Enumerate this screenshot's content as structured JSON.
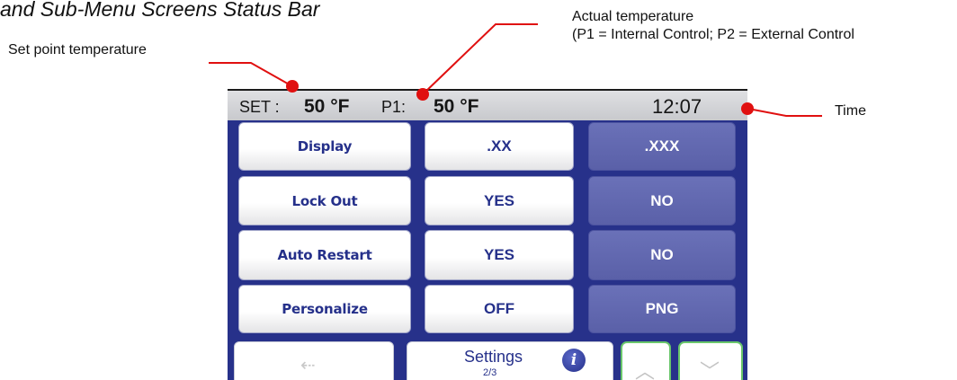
{
  "heading": "and Sub-Menu Screens Status Bar",
  "callouts": {
    "set_point": "Set point temperature",
    "actual_line1": "Actual temperature",
    "actual_line2": "(P1 = Internal Control; P2 = External Control",
    "time": "Time"
  },
  "colors": {
    "screen_background": "#27318a",
    "status_bar": "#c8c9cd",
    "button_white": "#ffffff",
    "button_selected": "#5a60a8",
    "leader_line": "#e01010",
    "nav_highlight": "#69c66b"
  },
  "status_bar": {
    "set_label": "SET :",
    "set_value": "50 °F",
    "probe_label": "P1:",
    "probe_value": "50 °F",
    "time": "12:07"
  },
  "menu": {
    "rows": [
      {
        "label": "Display",
        "option_a": ".XX",
        "option_b": ".XXX",
        "selected": "option_b"
      },
      {
        "label": "Lock Out",
        "option_a": "YES",
        "option_b": "NO",
        "selected": "option_b"
      },
      {
        "label": "Auto Restart",
        "option_a": "YES",
        "option_b": "NO",
        "selected": "option_b"
      },
      {
        "label": "Personalize",
        "option_a": "OFF",
        "option_b": "PNG",
        "selected": "option_b"
      }
    ]
  },
  "nav": {
    "back_icon": "back-arrow-icon",
    "back_glyph": "⇠",
    "title": "Settings",
    "page": "2/3",
    "info_icon": "info-icon",
    "info_glyph": "i",
    "up_icon": "chevron-up-icon",
    "up_glyph": "︿",
    "down_icon": "chevron-down-icon",
    "down_glyph": "﹀"
  }
}
